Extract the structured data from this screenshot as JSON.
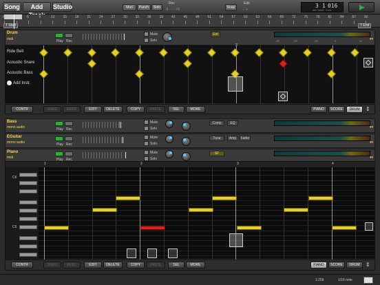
{
  "toolbar": {
    "song_label": "Song",
    "add_track_label": "Add Track",
    "studio_label": "Studio",
    "mon_label": "Mon",
    "punch_label": "Punch",
    "solo_label": "Solo",
    "rec_label": "Rec",
    "rec_ticks": "-5  --  --  +5",
    "snap_label": "Snap",
    "edit_label": "Edit",
    "edit_ticks": "--  +",
    "lcd_bar": "3",
    "lcd_beat": "1",
    "lcd_tick": "016",
    "lcd_sub": "bar  beat  tick"
  },
  "ruler": {
    "numbers": [
      "60",
      "3",
      "6",
      "9",
      "12",
      "15",
      "18",
      "21",
      "24",
      "27",
      "30",
      "33",
      "36",
      "39",
      "42",
      "45",
      "48",
      "51",
      "54",
      "57",
      "60",
      "63",
      "66",
      "69",
      "72",
      "75",
      "78",
      "81",
      "84",
      "87",
      "90"
    ],
    "start_flag": "T Start",
    "end_flag": "T End"
  },
  "drum_track": {
    "name": "Drum",
    "sub": "midi",
    "play": "Play",
    "rec": "Rec",
    "mute": "Mute",
    "solo": "Solo",
    "ext": "Ext",
    "meter_scale": [
      "-40",
      "-20",
      "-10",
      "0",
      "+4"
    ],
    "rows": [
      "Ride Bell",
      "Acoustic Snare",
      "Acoustic Bass"
    ],
    "add_instr": "Add Instr.",
    "bar_markers": [
      "3"
    ]
  },
  "edit_bar": {
    "contr": "CONTR",
    "undo": "UNDO",
    "redo": "REDO",
    "edit": "EDIT",
    "delete": "DELETE",
    "copy": "COPY",
    "paste": "PASTE",
    "sel": "SEL",
    "more": "MORE",
    "piano": "PIANO",
    "score": "SCORE",
    "drum": "DRUM"
  },
  "tracks": [
    {
      "name": "Bass",
      "sub": "mono audio",
      "fx": [
        "Comp",
        "EQ"
      ]
    },
    {
      "name": "EGuitar",
      "sub": "mono audio",
      "fx": [
        "Tune",
        "Amp",
        "Fader"
      ]
    },
    {
      "name": "Piano",
      "sub": "midi",
      "fx": [
        "SF"
      ]
    }
  ],
  "piano_roll": {
    "c_labels": [
      "C6",
      "C5"
    ],
    "bar_markers": [
      "1",
      "2",
      "3",
      "4"
    ]
  },
  "status": {
    "zoom": "1:256",
    "quant": "1/16 note"
  },
  "colors": {
    "accent_yellow": "#e6d227",
    "play_green": "#2fae3a",
    "record_red": "#e02020"
  }
}
